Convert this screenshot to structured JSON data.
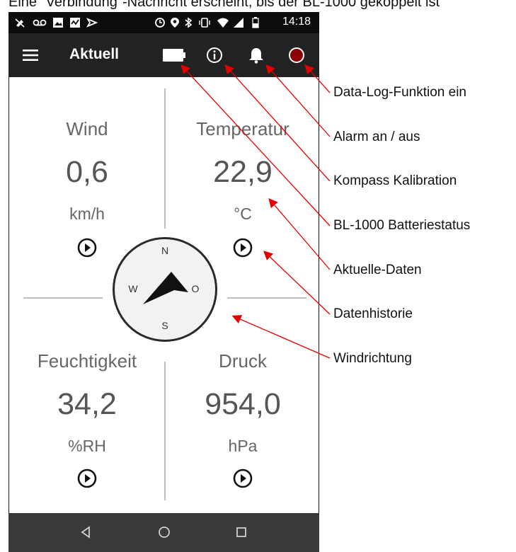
{
  "caption": "Eine \"Verbindung\"-Nachricht erscheint, bis der BL-1000 gekoppelt ist",
  "status_bar": {
    "time": "14:18"
  },
  "app_bar": {
    "title": "Aktuell",
    "icons": [
      "menu-icon",
      "battery-icon",
      "info-icon",
      "bell-icon",
      "record-icon"
    ]
  },
  "readings": {
    "wind": {
      "label": "Wind",
      "value": "0,6",
      "unit": "km/h"
    },
    "temperature": {
      "label": "Temperatur",
      "value": "22,9",
      "unit": "°C"
    },
    "humidity": {
      "label": "Feuchtigkeit",
      "value": "34,2",
      "unit": "%RH"
    },
    "pressure": {
      "label": "Druck",
      "value": "954,0",
      "unit": "hPa"
    }
  },
  "compass": {
    "north": "N",
    "east": "O",
    "south": "S",
    "west": "W"
  },
  "annotations": {
    "data_log": "Data-Log-Funktion ein",
    "alarm": "Alarm an / aus",
    "compass_cal": "Kompass Kalibration",
    "battery": "BL-1000 Batteriestatus",
    "current_data": "Aktuelle-Daten",
    "history": "Datenhistorie",
    "wind_direction": "Windrichtung"
  },
  "colors": {
    "status_bar": "#0d0d0d",
    "app_bar": "#222222",
    "nav_bar": "#3a3a3a",
    "arrow": "#e60000",
    "record": "#8b0000"
  }
}
